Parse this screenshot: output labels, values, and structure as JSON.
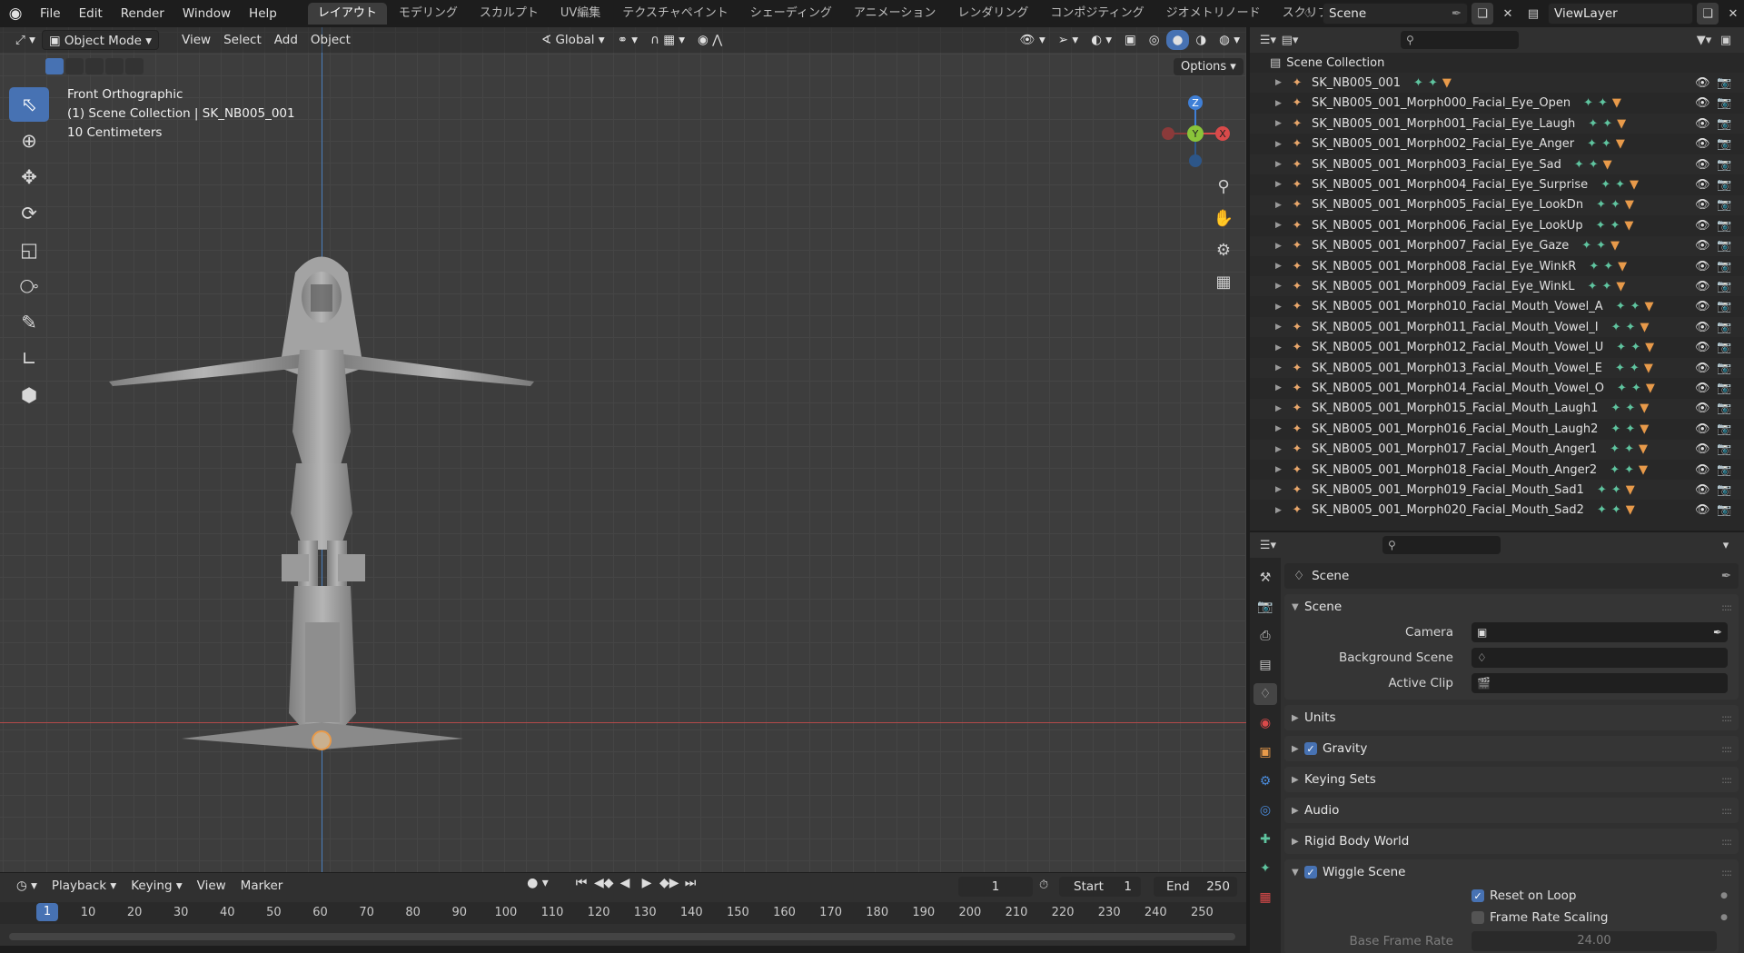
{
  "topbar": {
    "menus": [
      "File",
      "Edit",
      "Render",
      "Window",
      "Help"
    ],
    "workspaces": [
      "レイアウト",
      "モデリング",
      "スカルプト",
      "UV編集",
      "テクスチャペイント",
      "シェーディング",
      "アニメーション",
      "レンダリング",
      "コンポジティング",
      "ジオメトリノード",
      "スクリプト作成"
    ],
    "scene_name": "Scene",
    "view_layer": "ViewLayer"
  },
  "viewport": {
    "mode": "Object Mode",
    "menus": [
      "View",
      "Select",
      "Add",
      "Object"
    ],
    "transform_orientation": "Global",
    "options_label": "Options",
    "overlay_text": [
      "Front Orthographic",
      "(1) Scene Collection | SK_NB005_001",
      "10 Centimeters"
    ],
    "gizmo_axes": {
      "z": "Z",
      "y": "Y",
      "x": "X"
    }
  },
  "timeline": {
    "menus": [
      "Playback",
      "Keying",
      "View",
      "Marker"
    ],
    "current_frame": "1",
    "start_label": "Start",
    "start_value": "1",
    "end_label": "End",
    "end_value": "250",
    "ticks": [
      "10",
      "20",
      "30",
      "40",
      "50",
      "60",
      "70",
      "80",
      "90",
      "100",
      "110",
      "120",
      "130",
      "140",
      "150",
      "160",
      "170",
      "180",
      "190",
      "200",
      "210",
      "220",
      "230",
      "240",
      "250"
    ],
    "cursor_label": "1"
  },
  "outliner": {
    "root": "Scene Collection",
    "items": [
      "SK_NB005_001",
      "SK_NB005_001_Morph000_Facial_Eye_Open",
      "SK_NB005_001_Morph001_Facial_Eye_Laugh",
      "SK_NB005_001_Morph002_Facial_Eye_Anger",
      "SK_NB005_001_Morph003_Facial_Eye_Sad",
      "SK_NB005_001_Morph004_Facial_Eye_Surprise",
      "SK_NB005_001_Morph005_Facial_Eye_LookDn",
      "SK_NB005_001_Morph006_Facial_Eye_LookUp",
      "SK_NB005_001_Morph007_Facial_Eye_Gaze",
      "SK_NB005_001_Morph008_Facial_Eye_WinkR",
      "SK_NB005_001_Morph009_Facial_Eye_WinkL",
      "SK_NB005_001_Morph010_Facial_Mouth_Vowel_A",
      "SK_NB005_001_Morph011_Facial_Mouth_Vowel_I",
      "SK_NB005_001_Morph012_Facial_Mouth_Vowel_U",
      "SK_NB005_001_Morph013_Facial_Mouth_Vowel_E",
      "SK_NB005_001_Morph014_Facial_Mouth_Vowel_O",
      "SK_NB005_001_Morph015_Facial_Mouth_Laugh1",
      "SK_NB005_001_Morph016_Facial_Mouth_Laugh2",
      "SK_NB005_001_Morph017_Facial_Mouth_Anger1",
      "SK_NB005_001_Morph018_Facial_Mouth_Anger2",
      "SK_NB005_001_Morph019_Facial_Mouth_Sad1",
      "SK_NB005_001_Morph020_Facial_Mouth_Sad2"
    ]
  },
  "properties": {
    "context_title": "Scene",
    "scene_panel": "Scene",
    "camera_label": "Camera",
    "background_scene_label": "Background Scene",
    "active_clip_label": "Active Clip",
    "collapsed_panels": [
      "Units",
      "Gravity",
      "Keying Sets",
      "Audio",
      "Rigid Body World"
    ],
    "wiggle_panel": "Wiggle Scene",
    "reset_on_loop": "Reset on Loop",
    "frame_rate_scaling": "Frame Rate Scaling",
    "base_frame_rate_label": "Base Frame Rate",
    "base_frame_rate_value": "24.00"
  },
  "colors": {
    "accent": "#4772b3",
    "object_icon": "#e8a66a",
    "modifier_icon": "#5fc49f",
    "axis_x": "#d94a4a",
    "axis_y": "#8ac43a",
    "axis_z": "#3f7fd6"
  }
}
